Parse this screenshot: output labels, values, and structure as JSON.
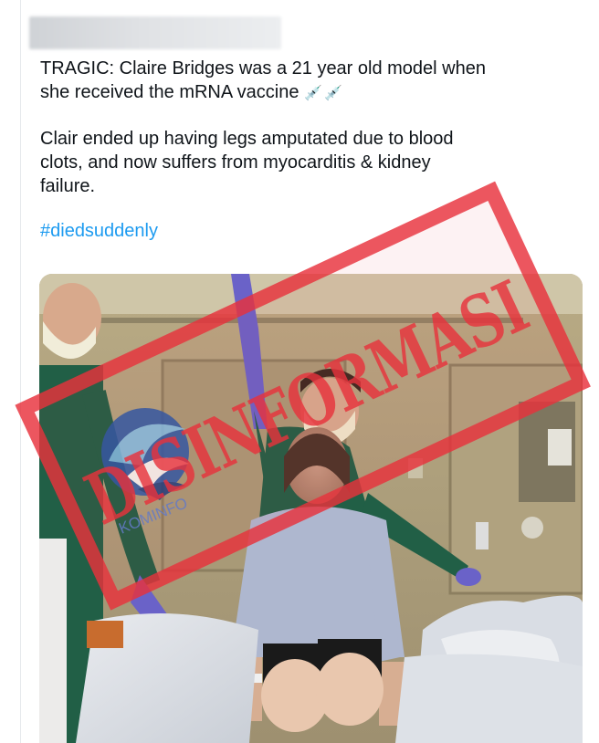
{
  "post": {
    "paragraph_1_line_1": "TRAGIC: Claire Bridges was a 21 year old model when",
    "paragraph_1_line_2": "she received the mRNA vaccine",
    "syringe_emoji": "💉💉",
    "paragraph_2_line_1": "Clair ended up having legs amputated due to blood",
    "paragraph_2_line_2": "clots, and now suffers from myocarditis & kidney",
    "paragraph_2_line_3": "failure.",
    "hashtag": "#diedsuddenly"
  },
  "stamp": {
    "text": "DISINFORMASI",
    "color": "#e8323c"
  },
  "watermark": {
    "logo_text": "KOMINFO",
    "icon": "kominfo-logo-icon"
  },
  "colors": {
    "text": "#0f1419",
    "link": "#1d9bf0",
    "scrubs": "#1f5e45",
    "gloves": "#6a62c8",
    "gown": "#aeb7cf"
  }
}
